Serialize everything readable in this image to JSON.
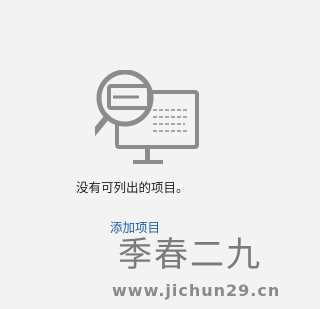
{
  "empty_state": {
    "illustration_icon": "search-monitor-icon",
    "message": "没有可列出的项目。",
    "add_link_label": "添加项目"
  },
  "watermark": {
    "title": "季春二九",
    "url": "www.jichun29.cn"
  },
  "colors": {
    "background": "#f3f3f3",
    "text": "#1f1f1f",
    "link": "#1a5ea8",
    "illustration_stroke": "#8c8c8c",
    "watermark": "#7a7a7a"
  }
}
